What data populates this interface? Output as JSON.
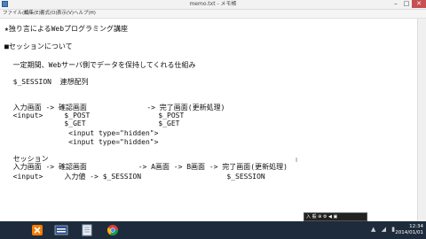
{
  "window": {
    "title": "memo.txt - メモ帳",
    "min": "–",
    "max": "□",
    "close": "✕"
  },
  "menu": [
    "ファイル(F)",
    "編集(E)",
    "書式(O)",
    "表示(V)",
    "ヘルプ(H)"
  ],
  "content": {
    "lines": [
      "★独り言によるWebプログラミング講座",
      "■セッションについて",
      "  一定期間、Webサーバ側でデータを保持してくれる仕組み",
      "  $_SESSION  連想配列",
      "  入力画面 -> 確認画面              -> 完了画面(更新処理)",
      "  <input>     $_POST                $_POST",
      "              $_GET                 $_GET",
      "               <input type=\"hidden\">",
      "               <input type=\"hidden\">",
      "  セッション",
      "  入力画面 -> 確認画面            -> A画面 -> B画面 -> 完了画面(更新処理)",
      "  <input>     入力値 -> $_SESSION                    $_SESSION"
    ]
  },
  "taskbar": {
    "tray_text": "入 般 ⊕ ⚙ ◀ ▣",
    "time": "12:34",
    "date": "2014/01/01"
  }
}
